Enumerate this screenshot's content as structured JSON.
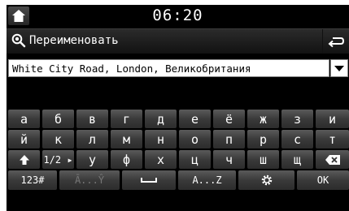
{
  "status_bar": {
    "time": "06:20",
    "home_icon": "home-icon"
  },
  "title_bar": {
    "title": "Переименовать",
    "icon": "search-icon",
    "back_icon": "back-return-icon"
  },
  "input": {
    "value": "White City Road, London, Великобритания",
    "dropdown_icon": "triangle-down-icon"
  },
  "keyboard": {
    "row1": [
      "а",
      "б",
      "в",
      "г",
      "д",
      "е",
      "ё",
      "ж",
      "з",
      "и"
    ],
    "row2": [
      "й",
      "к",
      "л",
      "м",
      "н",
      "о",
      "п",
      "р",
      "с",
      "т"
    ],
    "row3": [
      "у",
      "ф",
      "х",
      "ц",
      "ч",
      "ш",
      "щ"
    ],
    "page_label": "1/2 ▸",
    "shift_icon": "shift-up-arrow-icon",
    "backspace_icon": "backspace-icon",
    "bottom": {
      "numbers": "123#",
      "latin_disabled": "Ā...Ŷ",
      "space_icon": "space-bar-icon",
      "latin": "A...Z",
      "settings_icon": "settings-gear-icon",
      "ok": "OK"
    }
  }
}
